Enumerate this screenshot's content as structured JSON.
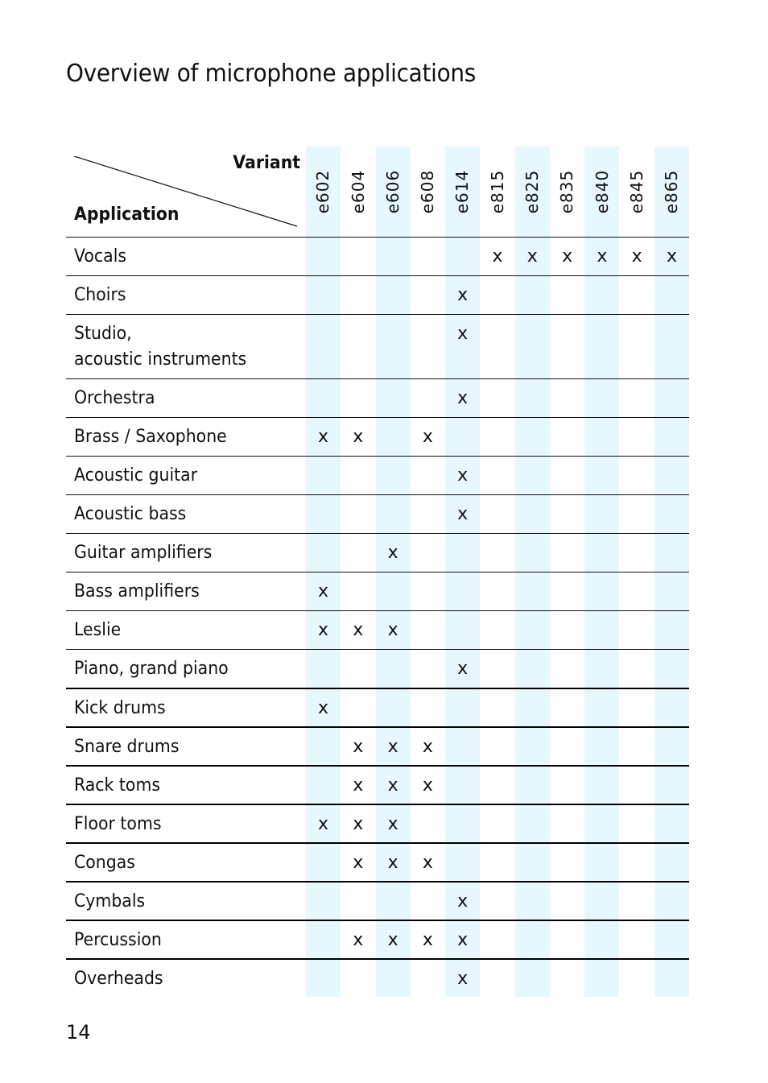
{
  "page": {
    "title": "Overview of microphone applications",
    "page_number": "14"
  },
  "table": {
    "corner_top_label": "Variant",
    "corner_bottom_label": "Application",
    "shaded_column_color": "#e6f7fd",
    "columns": [
      "e602",
      "e604",
      "e606",
      "e608",
      "e614",
      "e815",
      "e825",
      "e835",
      "e840",
      "e845",
      "e865"
    ],
    "mark_symbol": "x",
    "rows": [
      {
        "label": "Vocals",
        "marks": [
          "e815",
          "e825",
          "e835",
          "e840",
          "e845",
          "e865"
        ]
      },
      {
        "label": "Choirs",
        "marks": [
          "e614"
        ]
      },
      {
        "label": "Studio,\nacoustic instruments",
        "marks": [
          "e614"
        ]
      },
      {
        "label": "Orchestra",
        "marks": [
          "e614"
        ]
      },
      {
        "label": "Brass / Saxophone",
        "marks": [
          "e602",
          "e604",
          "e608"
        ]
      },
      {
        "label": "Acoustic guitar",
        "marks": [
          "e614"
        ]
      },
      {
        "label": "Acoustic bass",
        "marks": [
          "e614"
        ]
      },
      {
        "label": "Guitar amplifiers",
        "marks": [
          "e606"
        ]
      },
      {
        "label": "Bass amplifiers",
        "marks": [
          "e602"
        ]
      },
      {
        "label": "Leslie",
        "marks": [
          "e602",
          "e604",
          "e606"
        ]
      },
      {
        "label": "Piano, grand piano",
        "marks": [
          "e614"
        ]
      },
      {
        "label": "Kick drums",
        "marks": [
          "e602"
        ]
      },
      {
        "label": "Snare drums",
        "marks": [
          "e604",
          "e606",
          "e608"
        ]
      },
      {
        "label": "Rack toms",
        "marks": [
          "e604",
          "e606",
          "e608"
        ]
      },
      {
        "label": "Floor toms",
        "marks": [
          "e602",
          "e604",
          "e606"
        ]
      },
      {
        "label": "Congas",
        "marks": [
          "e604",
          "e606",
          "e608"
        ]
      },
      {
        "label": "Cymbals",
        "marks": [
          "e614"
        ]
      },
      {
        "label": "Percussion",
        "marks": [
          "e604",
          "e606",
          "e608",
          "e614"
        ]
      },
      {
        "label": "Overheads",
        "marks": [
          "e614"
        ]
      }
    ]
  }
}
